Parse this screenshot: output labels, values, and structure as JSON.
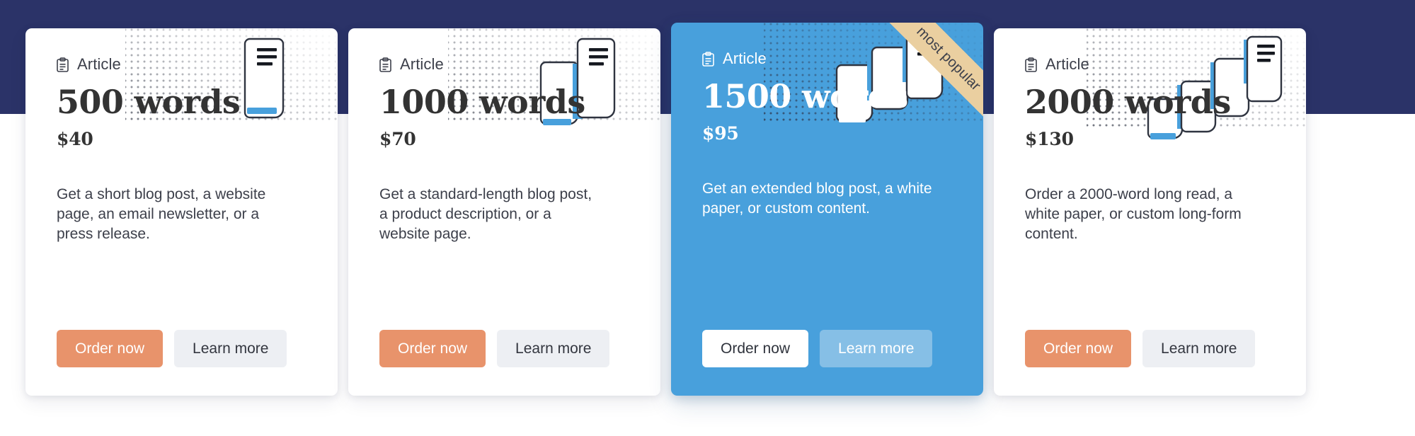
{
  "theme": {
    "band_color": "#2b3368",
    "page_background": "#ffffff",
    "featured_color": "#48a0dc",
    "primary_button_color": "#e8936b",
    "secondary_button_color": "#edeff3",
    "ribbon_color": "#eacfa0",
    "heading_color": "#333333",
    "accent_illustration_color": "#48a0dc"
  },
  "cards": [
    {
      "kicker": "Article",
      "kicker_icon": "clipboard-icon",
      "headline": "500 words",
      "price": "$40",
      "description": "Get a short blog post, a website page, an email newsletter, or a press release.",
      "primary_button": "Order now",
      "secondary_button": "Learn more",
      "featured": false,
      "ribbon": null
    },
    {
      "kicker": "Article",
      "kicker_icon": "clipboard-icon",
      "headline": "1000 words",
      "price": "$70",
      "description": "Get a standard-length blog post, a product description, or a website page.",
      "primary_button": "Order now",
      "secondary_button": "Learn more",
      "featured": false,
      "ribbon": null
    },
    {
      "kicker": "Article",
      "kicker_icon": "clipboard-icon",
      "headline": "1500 words",
      "price": "$95",
      "description": "Get an extended blog post, a white paper, or custom content.",
      "primary_button": "Order now",
      "secondary_button": "Learn more",
      "featured": true,
      "ribbon": "most popular"
    },
    {
      "kicker": "Article",
      "kicker_icon": "clipboard-icon",
      "headline": "2000 words",
      "price": "$130",
      "description": "Order a 2000-word long read, a white paper, or custom long-form content.",
      "primary_button": "Order now",
      "secondary_button": "Learn more",
      "featured": false,
      "ribbon": null
    }
  ]
}
